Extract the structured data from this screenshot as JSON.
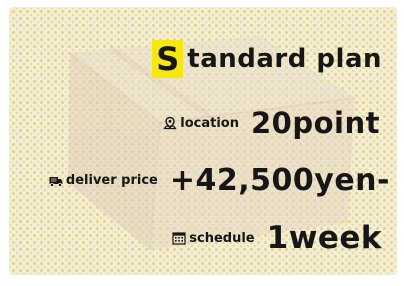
{
  "title": {
    "initial": "S",
    "rest": "tandard plan"
  },
  "location": {
    "icon": "map-pin-icon",
    "label": "location",
    "value": "20point"
  },
  "price": {
    "icon": "truck-icon",
    "label": "deliver price",
    "value": "+42,500yen-"
  },
  "schedule": {
    "icon": "calendar-icon",
    "label": "schedule",
    "value": "1week"
  },
  "colors": {
    "highlight": "#f6e80e",
    "text": "#161616",
    "dots": "#ded278",
    "background": "#f4eeda",
    "box": "#e6d5c1"
  }
}
